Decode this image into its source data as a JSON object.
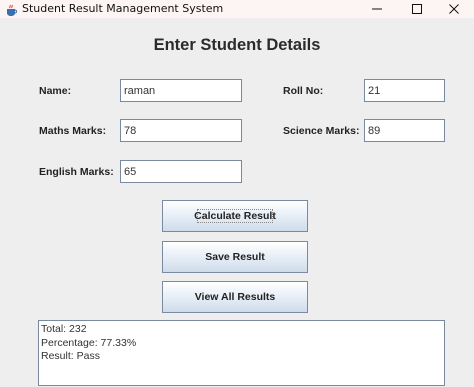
{
  "window": {
    "title": "Student Result Management System"
  },
  "form": {
    "heading": "Enter Student Details",
    "name_label": "Name:",
    "name_value": "raman",
    "roll_label": "Roll No:",
    "roll_value": "21",
    "maths_label": "Maths Marks:",
    "maths_value": "78",
    "science_label": "Science Marks:",
    "science_value": "89",
    "english_label": "English Marks:",
    "english_value": "65"
  },
  "buttons": {
    "calculate": "Calculate Result",
    "save": "Save Result",
    "view_all": "View All Results"
  },
  "result": {
    "lines": [
      "Total: 232",
      "Percentage: 77.33%",
      "Result: Pass"
    ]
  },
  "icons": {
    "app": "java-cup-icon",
    "minimize": "minimize-icon",
    "maximize": "maximize-icon",
    "close": "close-icon"
  }
}
